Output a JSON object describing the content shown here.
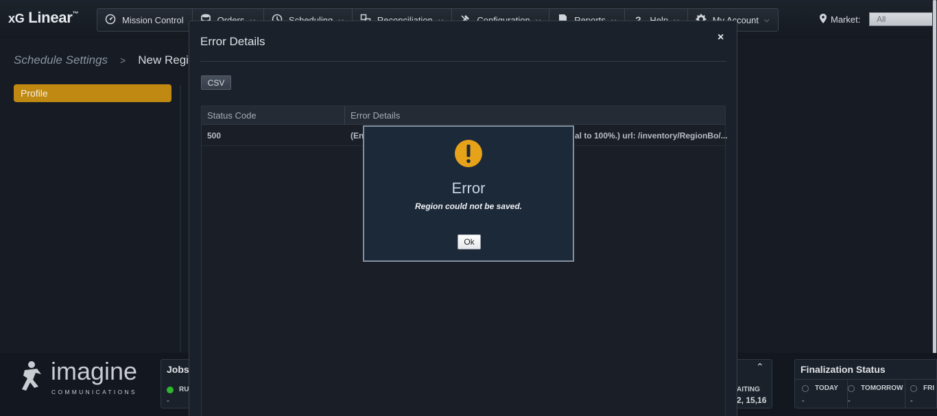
{
  "app": {
    "name": "xG Linear",
    "name_prefix": "xG",
    "name_main": "Linear",
    "trademark": "™"
  },
  "nav": [
    {
      "label": "Mission Control",
      "icon": "gauge-icon"
    },
    {
      "label": "Orders",
      "icon": "database-icon"
    },
    {
      "label": "Scheduling",
      "icon": "clock-icon"
    },
    {
      "label": "Reconciliation",
      "icon": "reconcile-icon"
    },
    {
      "label": "Configuration",
      "icon": "tools-icon"
    },
    {
      "label": "Reports",
      "icon": "document-icon"
    },
    {
      "label": "Help",
      "icon": "question-icon"
    },
    {
      "label": "My Account",
      "icon": "gear-icon"
    }
  ],
  "market": {
    "label": "Market:",
    "value": "All"
  },
  "breadcrumb": {
    "parent": "Schedule Settings",
    "separator": ">",
    "current": "New Region"
  },
  "sidebar": {
    "profile_label": "Profile"
  },
  "footer": {
    "brand": "imagine",
    "brand_sub": "COMMUNICATIONS",
    "jobs": {
      "title": "Jobs",
      "status_label": "RU",
      "value": "-"
    },
    "waiting": {
      "label": "AITING",
      "value": "2, 15,16"
    },
    "finalization": {
      "title": "Finalization Status",
      "cells": [
        {
          "label": "TODAY",
          "value": "-"
        },
        {
          "label": "TOMORROW",
          "value": "-"
        },
        {
          "label": "FRI T",
          "value": "-"
        }
      ]
    }
  },
  "error_modal": {
    "title": "Error Details",
    "close_glyph": "×",
    "csv_label": "CSV",
    "columns": [
      "Status Code",
      "Error Details"
    ],
    "rows": [
      {
        "status_code": "500",
        "details_left": "(En",
        "details_right": "al to 100%.) url: /inventory/RegionBo/..."
      }
    ]
  },
  "alert": {
    "title": "Error",
    "message": "Region could not be saved.",
    "ok_label": "Ok",
    "icon_color": "#e6a219"
  },
  "colors": {
    "accent": "#c08a12",
    "background": "#171c24",
    "panel": "#1b212a"
  }
}
